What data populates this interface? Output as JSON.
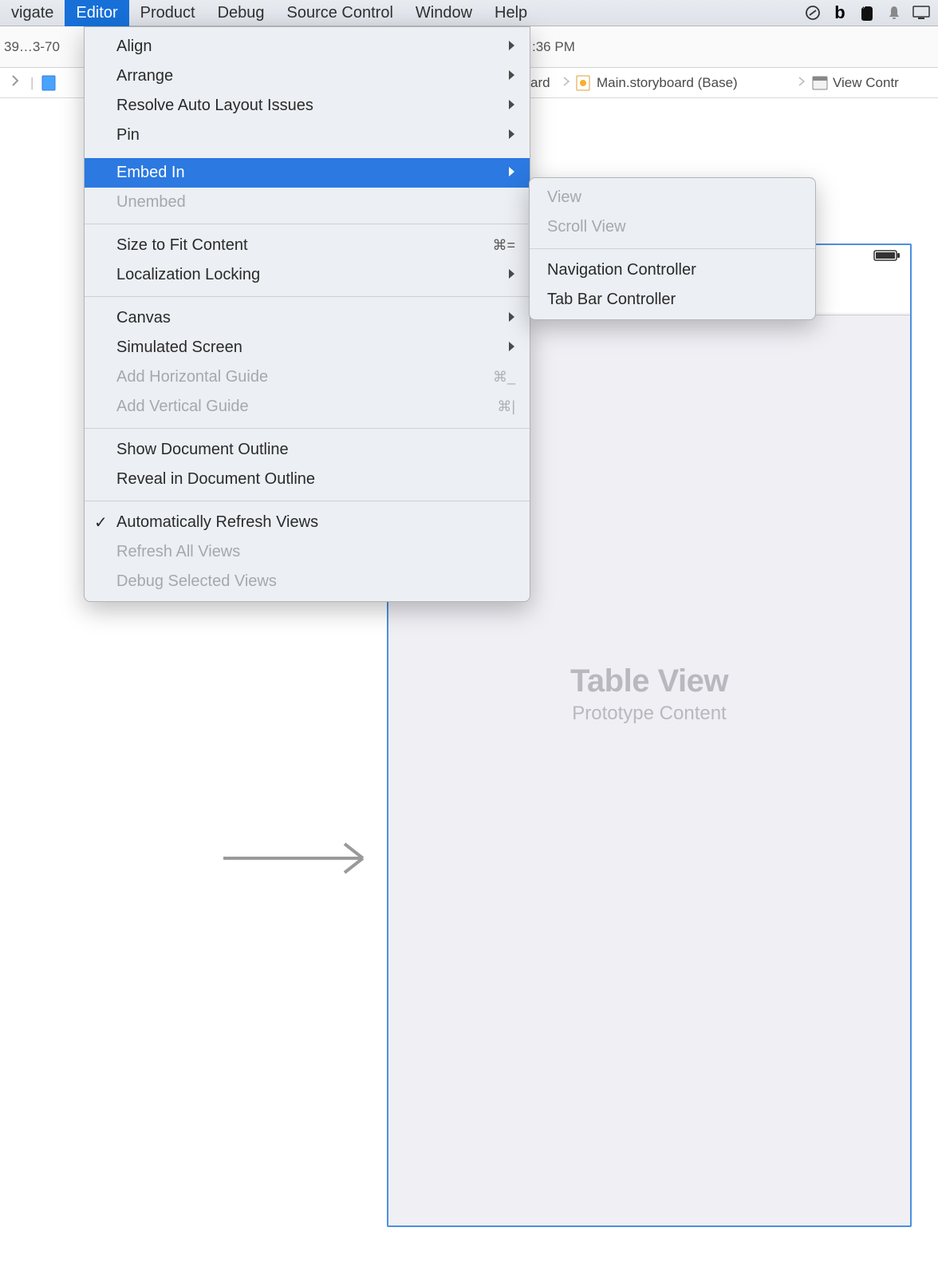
{
  "menubar": {
    "items_left_partial": "vigate",
    "items": [
      "Editor",
      "Product",
      "Debug",
      "Source Control",
      "Window",
      "Help"
    ]
  },
  "toolbar": {
    "text_left": "39…3-70",
    "text_right": ":36 PM"
  },
  "pathbar": {
    "crumb_ard": "ard",
    "crumb_main": "Main.storyboard (Base)",
    "crumb_vc": "View Contr"
  },
  "editor_menu": {
    "align": "Align",
    "arrange": "Arrange",
    "resolve": "Resolve Auto Layout Issues",
    "pin": "Pin",
    "embed_in": "Embed In",
    "unembed": "Unembed",
    "size_fit": "Size to Fit Content",
    "size_fit_sc": "⌘=",
    "localization": "Localization Locking",
    "canvas": "Canvas",
    "sim_screen": "Simulated Screen",
    "add_h_guide": "Add Horizontal Guide",
    "add_h_guide_sc": "⌘_",
    "add_v_guide": "Add Vertical Guide",
    "add_v_guide_sc": "⌘|",
    "show_outline": "Show Document Outline",
    "reveal_outline": "Reveal in Document Outline",
    "auto_refresh": "Automatically Refresh Views",
    "refresh_all": "Refresh All Views",
    "debug_views": "Debug Selected Views"
  },
  "embed_submenu": {
    "view": "View",
    "scroll_view": "Scroll View",
    "nav_ctrl": "Navigation Controller",
    "tab_ctrl": "Tab Bar Controller"
  },
  "canvas": {
    "table_title": "Table View",
    "table_sub": "Prototype Content"
  }
}
